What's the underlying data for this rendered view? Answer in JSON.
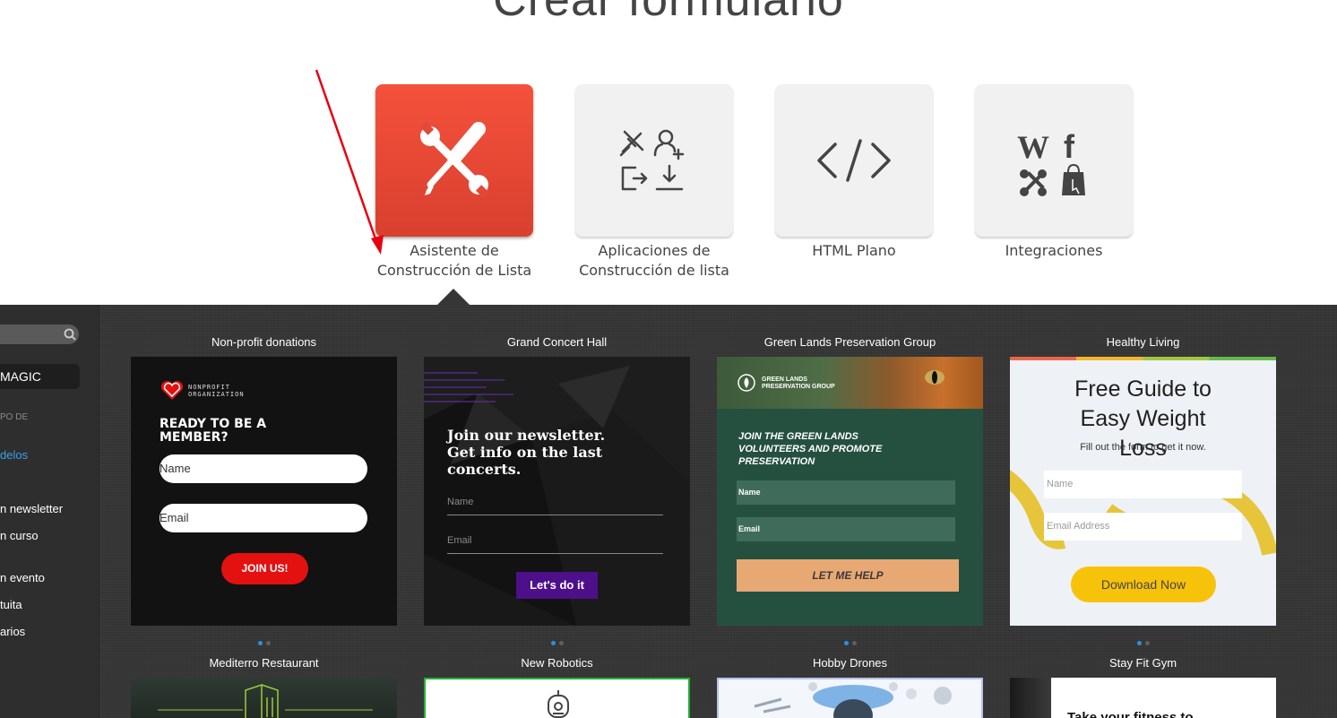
{
  "page": {
    "title": "Crear formulario"
  },
  "form_types": [
    {
      "label": "Asistente de Construcción de Lista",
      "icon": "tools-icon",
      "active": true
    },
    {
      "label": "Aplicaciones de Construcción de lista",
      "icon": "apps-icons",
      "active": false
    },
    {
      "label": "HTML Plano",
      "icon": "code-icon",
      "active": false
    },
    {
      "label": "Integraciones",
      "icon": "integrations-icons",
      "active": false
    }
  ],
  "sidebar": {
    "magic_label": "MAGIC",
    "section_label": "PO DE",
    "links": [
      {
        "label": "delos",
        "highlight": true
      },
      {
        "label": "n newsletter",
        "highlight": false
      },
      {
        "label": "n curso",
        "highlight": false
      },
      {
        "label": "n evento",
        "highlight": false
      },
      {
        "label": "tuita",
        "highlight": false
      },
      {
        "label": "arios",
        "highlight": false
      }
    ]
  },
  "templates": [
    {
      "title": "Non-profit donations",
      "logo_text": "NONPROFIT\nORGANIZATION",
      "headline": "READY TO BE A MEMBER?",
      "fields": [
        "Name",
        "Email"
      ],
      "button": "JOIN US!"
    },
    {
      "title": "Grand Concert Hall",
      "headline": "Join our newsletter. Get info on the last concerts.",
      "fields": [
        "Name",
        "Email"
      ],
      "button": "Let's do it"
    },
    {
      "title": "Green Lands Preservation Group",
      "brand": "GREEN LANDS\nPRESERVATION GROUP",
      "headline": "JOIN THE GREEN LANDS VOLUNTEERS AND PROMOTE PRESERVATION",
      "fields": [
        "Name",
        "Email"
      ],
      "button": "LET ME HELP"
    },
    {
      "title": "Healthy Living",
      "headline": "Free Guide to Easy Weight Loss",
      "subtext": "Fill out the form to get it now.",
      "fields": [
        "Name",
        "Email Address"
      ],
      "button": "Download Now"
    },
    {
      "title": "Mediterro Restaurant"
    },
    {
      "title": "New Robotics"
    },
    {
      "title": "Hobby Drones"
    },
    {
      "title": "Stay Fit Gym",
      "headline": "Take your fitness to"
    }
  ],
  "colors": {
    "accent": "#e8483a",
    "dark_bg": "#363636",
    "link": "#3aa0e8"
  }
}
